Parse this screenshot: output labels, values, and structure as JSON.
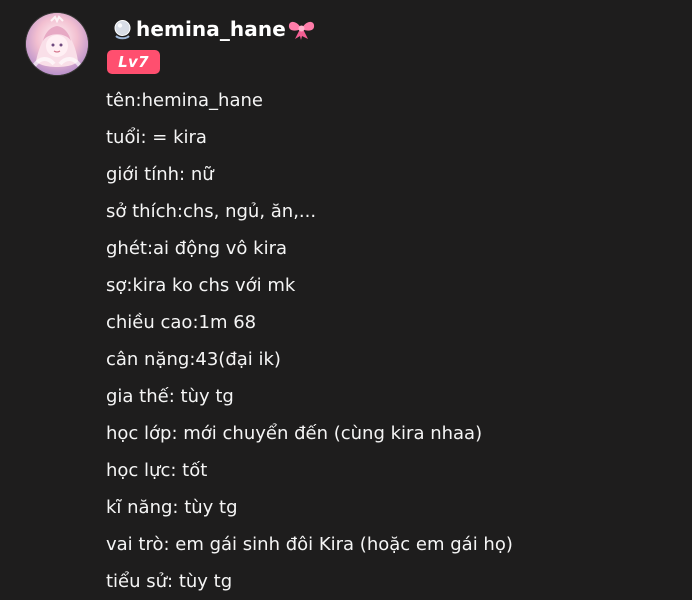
{
  "profile": {
    "username": "hemina_hane",
    "level": "Lv7",
    "leading_icon": "silver-orb-emoji",
    "trailing_icon": "pink-ribbon-emoji",
    "badge_color": "#ff4f6f"
  },
  "bio_lines": [
    "tên:hemina_hane",
    "tuổi: = kira",
    "giới tính: nữ",
    "sở thích:chs, ngủ, ăn,...",
    "ghét:ai động vô kira",
    "sợ:kira ko chs với mk",
    "chiều cao:1m 68",
    "cân nặng:43(đại ik)",
    "gia thế: tùy tg",
    "học lớp: mới chuyển đến (cùng kira nhaa)",
    "học lực: tốt",
    "kĩ năng: tùy tg",
    "vai trò: em gái sinh đôi Kira (hoặc em gái họ)",
    "tiểu sử: tùy tg"
  ]
}
